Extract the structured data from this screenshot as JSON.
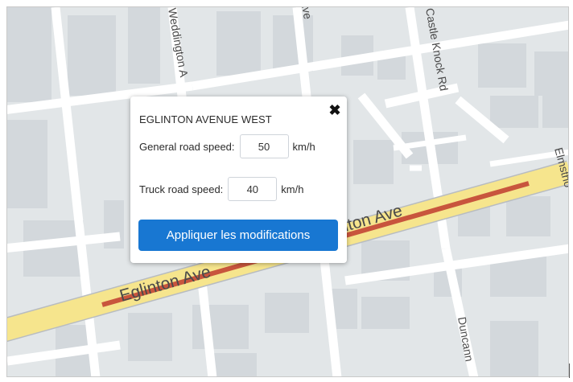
{
  "map": {
    "streets": {
      "eglinton_main": "Eglinton Ave",
      "eglinton_right": "Eglinton Ave",
      "weddington": "Weddington A",
      "ave_top": "Ave",
      "castle_knock": "Castle Knock Rd",
      "duncannon": "Duncann",
      "elmsthorpe": "Elmstho"
    },
    "colors": {
      "land": "#e2e6e8",
      "block": "#d3d8dc",
      "road": "#ffffff",
      "arterial": "#f6e58d",
      "congestion": "#c8553d"
    }
  },
  "popup": {
    "title": "EGLINTON AVENUE WEST",
    "close_icon": "close-icon",
    "general": {
      "label": "General road speed:",
      "value": "50",
      "unit": "km/h"
    },
    "truck": {
      "label": "Truck road speed:",
      "value": "40",
      "unit": "km/h"
    },
    "apply_label": "Appliquer les modifications",
    "accent": "#1877d2"
  }
}
